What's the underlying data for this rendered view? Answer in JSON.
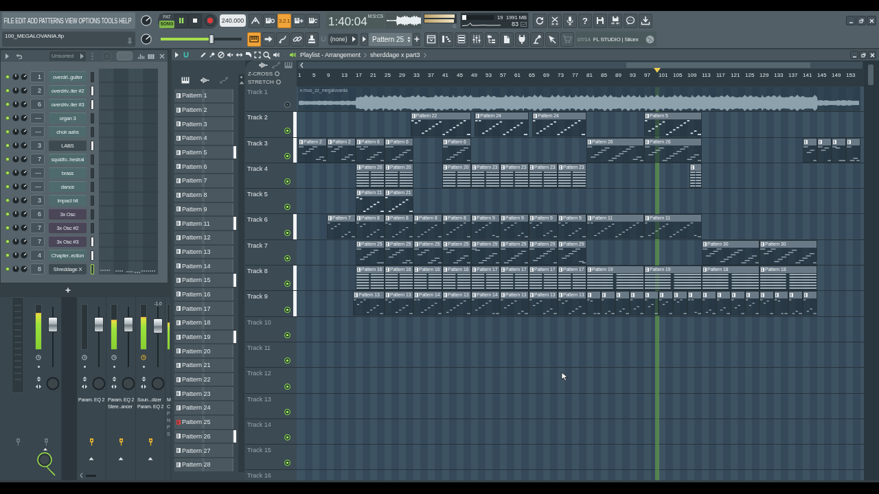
{
  "toolbar": {
    "menu": [
      "FILE",
      "EDIT",
      "ADD",
      "PATTERNS",
      "VIEW",
      "OPTIONS",
      "TOOLS",
      "HELP"
    ],
    "file_name": "100_MEGALOVANIA.flp",
    "modes": [
      {
        "label": "PAT",
        "selected": false
      },
      {
        "label": "SONG",
        "selected": true
      }
    ],
    "playing": true,
    "tempo": "240.000",
    "record_options": [
      {
        "on": false
      },
      {
        "on": false
      },
      {
        "label": "3.2.1",
        "on": true
      },
      {
        "on": false
      },
      {
        "on": false
      }
    ],
    "time": {
      "value": "1:40:04",
      "format": "M:S:CS"
    },
    "peak_meters": [
      {
        "level": 0.96
      },
      {
        "level": 0.93
      }
    ],
    "cpu": {
      "level": 0.12,
      "reading": "19",
      "memory": "1991 MB",
      "count": "83"
    },
    "help_button": "?",
    "master_volume": {
      "level": 0.63
    },
    "tools": [
      {
        "on": true
      },
      {
        "on": false
      },
      {
        "on": false
      },
      {
        "on": false
      },
      {
        "on": false
      }
    ],
    "dropdown": "(none)",
    "pattern": "Pattern 25",
    "hint": {
      "counter": "07/14",
      "text": "FL STUDIO | Slicex"
    }
  },
  "channel_rack": {
    "filter": "Unsorted",
    "channels": [
      {
        "number": "1",
        "name": "overdri..guiter",
        "color": "#4e6a6c",
        "selected": false,
        "focused": false
      },
      {
        "number": "2",
        "name": "overdriv..iter #2",
        "color": "#4e6a6c",
        "selected": true,
        "focused": false
      },
      {
        "number": "6",
        "name": "overdriv..iter #3",
        "color": "#4e6a6c",
        "selected": true,
        "focused": false
      },
      {
        "number": "---",
        "name": "organ 3",
        "color": "#4e6a6c",
        "selected": false,
        "focused": false
      },
      {
        "number": "---",
        "name": "choir aahs",
        "color": "#4e6a6c",
        "selected": false,
        "focused": false
      },
      {
        "number": "3",
        "name": "LABS",
        "color": "#3d4a50",
        "selected": true,
        "focused": false
      },
      {
        "number": "7",
        "name": "squidfo..hestral",
        "color": "#4e6a6c",
        "selected": false,
        "focused": false
      },
      {
        "number": "---",
        "name": "brass",
        "color": "#4e6a6c",
        "selected": false,
        "focused": false
      },
      {
        "number": "---",
        "name": "dance",
        "color": "#4e6a6c",
        "selected": false,
        "focused": false
      },
      {
        "number": "3",
        "name": "impact hit",
        "color": "#4e6a6c",
        "selected": false,
        "focused": false
      },
      {
        "number": "6",
        "name": "3x Osc",
        "color": "#4b4558",
        "selected": false,
        "focused": false
      },
      {
        "number": "7",
        "name": "3x Osc #2",
        "color": "#4b4558",
        "selected": false,
        "focused": false
      },
      {
        "number": "7",
        "name": "3x Osc #3",
        "color": "#4b4558",
        "selected": true,
        "focused": false
      },
      {
        "number": "4",
        "name": "Chapter..ection",
        "color": "#4e6a6c",
        "selected": true,
        "focused": false
      },
      {
        "number": "8",
        "name": "Shreddage X",
        "color": "#3d4a50",
        "selected": false,
        "focused": true
      }
    ]
  },
  "mixer": {
    "strips": [
      {
        "meter": {
          "level": 0.82
        },
        "fader": {
          "level": 0.78
        },
        "clock_on": false,
        "plug_on": false,
        "routed": true
      },
      {
        "meter": {
          "level": 0
        },
        "fader": {
          "level": 0.78
        },
        "clock_on": false,
        "plug_on": true,
        "routed": false,
        "fx": [
          {
            "label": "Param. EQ 2",
            "enabled": true
          }
        ]
      },
      {
        "meter": {
          "level": 0.66
        },
        "fader": {
          "level": 0.78
        },
        "clock_on": false,
        "plug_on": true,
        "routed": false,
        "fx": [
          {
            "label": "Param. EQ 2",
            "enabled": true
          },
          {
            "label": "Stere..ancer",
            "enabled": true
          }
        ]
      },
      {
        "meter": {
          "level": 0.73
        },
        "fader": {
          "level": 0.74
        },
        "reading": "-1.0",
        "clock_on": true,
        "plug_on": true,
        "routed": false,
        "fx": [
          {
            "label": "Soun...dizer",
            "enabled": true
          },
          {
            "label": "Param. EQ 2",
            "enabled": true
          }
        ]
      },
      {
        "meter": {
          "level": 0.6
        },
        "fx": [
          {
            "label": "M",
            "enabled": true
          },
          {
            "label": "C",
            "enabled": true
          },
          {
            "label": "P",
            "enabled": false
          },
          {
            "label": "N",
            "enabled": false
          },
          {
            "label": "P",
            "enabled": false
          },
          {
            "label": "S",
            "enabled": false
          }
        ]
      }
    ]
  },
  "playlist": {
    "title": "Playlist - Arrangement",
    "breadcrumb": "sherddage x part3",
    "options": [
      {
        "label": "Z-CROSS",
        "on": false
      },
      {
        "label": "STRETCH",
        "on": false
      }
    ],
    "patterns": [
      {
        "label": "Pattern 1",
        "selected": false,
        "current": false
      },
      {
        "label": "Pattern 2",
        "selected": false,
        "current": false
      },
      {
        "label": "Pattern 3",
        "selected": false,
        "current": false
      },
      {
        "label": "Pattern 4",
        "selected": false,
        "current": false
      },
      {
        "label": "Pattern 5",
        "selected": true,
        "current": false
      },
      {
        "label": "Pattern 6",
        "selected": false,
        "current": false
      },
      {
        "label": "Pattern 7",
        "selected": false,
        "current": false
      },
      {
        "label": "Pattern 8",
        "selected": false,
        "current": false
      },
      {
        "label": "Pattern 9",
        "selected": false,
        "current": false
      },
      {
        "label": "Pattern 11",
        "selected": true,
        "current": false
      },
      {
        "label": "Pattern 12",
        "selected": false,
        "current": false
      },
      {
        "label": "Pattern 13",
        "selected": false,
        "current": false
      },
      {
        "label": "Pattern 14",
        "selected": false,
        "current": false
      },
      {
        "label": "Pattern 15",
        "selected": true,
        "current": false
      },
      {
        "label": "Pattern 16",
        "selected": false,
        "current": false
      },
      {
        "label": "Pattern 17",
        "selected": false,
        "current": false
      },
      {
        "label": "Pattern 18",
        "selected": false,
        "current": false
      },
      {
        "label": "Pattern 19",
        "selected": true,
        "current": false
      },
      {
        "label": "Pattern 20",
        "selected": false,
        "current": false
      },
      {
        "label": "Pattern 21",
        "selected": false,
        "current": false
      },
      {
        "label": "Pattern 22",
        "selected": false,
        "current": false
      },
      {
        "label": "Pattern 23",
        "selected": false,
        "current": false
      },
      {
        "label": "Pattern 24",
        "selected": false,
        "current": false
      },
      {
        "label": "Pattern 25",
        "selected": false,
        "current": true
      },
      {
        "label": "Pattern 26",
        "selected": true,
        "current": false
      },
      {
        "label": "Pattern 27",
        "selected": false,
        "current": false
      },
      {
        "label": "Pattern 28",
        "selected": false,
        "current": false
      }
    ],
    "ruler": [
      "1",
      "5",
      "9",
      "13",
      "17",
      "21",
      "25",
      "29",
      "33",
      "37",
      "41",
      "45",
      "49",
      "53",
      "57",
      "61",
      "65",
      "69",
      "73",
      "77",
      "81",
      "85",
      "89",
      "93",
      "97",
      "101",
      "105",
      "109",
      "113",
      "117",
      "121",
      "125",
      "129",
      "133",
      "137",
      "141",
      "145",
      "149",
      "153"
    ],
    "playhead": {
      "level": 0.639
    },
    "tracks": [
      {
        "name": "Track 1",
        "selected": false,
        "muted": true,
        "dimmed": true,
        "clips": [
          {
            "kind": "audio",
            "label": "mus_zz_megalovania"
          }
        ]
      },
      {
        "name": "Track 2",
        "selected": true,
        "muted": false,
        "dimmed": false,
        "clips": [
          {
            "kind": "pattern",
            "label": "Pattern 22"
          },
          {
            "kind": "pattern",
            "label": "Pattern 24"
          },
          {
            "kind": "pattern",
            "label": "Pattern 24"
          },
          {
            "kind": "pattern",
            "label": "Pattern 5"
          }
        ]
      },
      {
        "name": "Track 3",
        "selected": true,
        "muted": false,
        "dimmed": false,
        "clips": [
          {
            "kind": "pattern",
            "label": "Pattern 2"
          },
          {
            "kind": "pattern",
            "label": "Pattern 2"
          },
          {
            "kind": "pattern",
            "label": "Pattern 6"
          },
          {
            "kind": "pattern",
            "label": "Pattern 6"
          },
          {
            "kind": "pattern",
            "label": "Pattern 6"
          },
          {
            "kind": "pattern",
            "label": "Pattern 26"
          },
          {
            "kind": "pattern",
            "label": "Pattern 26"
          },
          {
            "kind": "pattern"
          },
          {
            "kind": "pattern"
          },
          {
            "kind": "pattern"
          },
          {
            "kind": "pattern"
          }
        ]
      },
      {
        "name": "Track 4",
        "selected": false,
        "muted": false,
        "dimmed": false,
        "clips": [
          {
            "kind": "pattern",
            "label": "Pattern 20"
          },
          {
            "kind": "pattern",
            "label": "Pattern 20"
          },
          {
            "kind": "pattern",
            "label": "Pattern 20"
          },
          {
            "kind": "pattern",
            "label": "Pattern 23"
          },
          {
            "kind": "pattern",
            "label": "Pattern 23"
          },
          {
            "kind": "pattern",
            "label": "Pattern 23"
          },
          {
            "kind": "pattern",
            "label": "Pattern 23"
          },
          {
            "kind": "pattern"
          }
        ]
      },
      {
        "name": "Track 5",
        "selected": false,
        "muted": false,
        "dimmed": false,
        "clips": [
          {
            "kind": "pattern",
            "label": "Pattern 21"
          },
          {
            "kind": "pattern",
            "label": "Pattern 21"
          }
        ]
      },
      {
        "name": "Track 6",
        "selected": true,
        "muted": false,
        "dimmed": false,
        "clips": [
          {
            "kind": "pattern",
            "label": "Pattern 7"
          },
          {
            "kind": "pattern",
            "label": "Pattern 8"
          },
          {
            "kind": "pattern",
            "label": "Pattern 8"
          },
          {
            "kind": "pattern",
            "label": "Pattern 8"
          },
          {
            "kind": "pattern",
            "label": "Pattern 8"
          },
          {
            "kind": "pattern",
            "label": "Pattern 9"
          },
          {
            "kind": "pattern",
            "label": "Pattern 9"
          },
          {
            "kind": "pattern",
            "label": "Pattern 9"
          },
          {
            "kind": "pattern",
            "label": "Pattern 9"
          },
          {
            "kind": "pattern",
            "label": "Pattern 11"
          },
          {
            "kind": "pattern",
            "label": "Pattern 11"
          }
        ]
      },
      {
        "name": "Track 7",
        "selected": false,
        "muted": false,
        "dimmed": false,
        "clips": [
          {
            "kind": "pattern",
            "label": "Pattern 25"
          },
          {
            "kind": "pattern",
            "label": "Pattern 25"
          },
          {
            "kind": "pattern",
            "label": "Pattern 25"
          },
          {
            "kind": "pattern",
            "label": "Pattern 25"
          },
          {
            "kind": "pattern",
            "label": "Pattern 29"
          },
          {
            "kind": "pattern",
            "label": "Pattern 29"
          },
          {
            "kind": "pattern",
            "label": "Pattern 29"
          },
          {
            "kind": "pattern",
            "label": "Pattern 29"
          },
          {
            "kind": "pattern",
            "label": "Pattern 30"
          },
          {
            "kind": "pattern",
            "label": "Pattern 30"
          }
        ]
      },
      {
        "name": "Track 8",
        "selected": true,
        "muted": false,
        "dimmed": false,
        "clips": [
          {
            "kind": "pattern",
            "label": "Pattern 16"
          },
          {
            "kind": "pattern",
            "label": "Pattern 16"
          },
          {
            "kind": "pattern",
            "label": "Pattern 16"
          },
          {
            "kind": "pattern",
            "label": "Pattern 16"
          },
          {
            "kind": "pattern",
            "label": "Pattern 17"
          },
          {
            "kind": "pattern",
            "label": "Pattern 17"
          },
          {
            "kind": "pattern",
            "label": "Pattern 17"
          },
          {
            "kind": "pattern",
            "label": "Pattern 17"
          },
          {
            "kind": "pattern",
            "label": "Pattern 19"
          },
          {
            "kind": "pattern",
            "label": "Pattern 19"
          },
          {
            "kind": "pattern",
            "label": "Pattern 18"
          },
          {
            "kind": "pattern",
            "label": "Pattern 18"
          }
        ]
      },
      {
        "name": "Track 9",
        "selected": true,
        "muted": false,
        "dimmed": false,
        "clips": [
          {
            "kind": "pattern",
            "label": "Pattern 13"
          },
          {
            "kind": "pattern",
            "label": "Pattern 13"
          },
          {
            "kind": "pattern",
            "label": "Pattern 14"
          },
          {
            "kind": "pattern",
            "label": "Pattern 13"
          },
          {
            "kind": "pattern",
            "label": "Pattern 14"
          },
          {
            "kind": "pattern",
            "label": "Pattern 13"
          },
          {
            "kind": "pattern",
            "label": "Pattern 13"
          },
          {
            "kind": "pattern",
            "label": "Pattern 13"
          },
          {
            "kind": "pattern"
          },
          {
            "kind": "pattern"
          },
          {
            "kind": "pattern"
          },
          {
            "kind": "pattern"
          },
          {
            "kind": "pattern"
          },
          {
            "kind": "pattern"
          },
          {
            "kind": "pattern"
          },
          {
            "kind": "pattern"
          },
          {
            "kind": "pattern"
          },
          {
            "kind": "pattern"
          },
          {
            "kind": "pattern"
          },
          {
            "kind": "pattern"
          },
          {
            "kind": "pattern"
          },
          {
            "kind": "pattern"
          },
          {
            "kind": "pattern"
          },
          {
            "kind": "pattern"
          }
        ]
      },
      {
        "name": "Track 10",
        "selected": false,
        "muted": false,
        "dimmed": true
      },
      {
        "name": "Track 11",
        "selected": false,
        "muted": false,
        "dimmed": true
      },
      {
        "name": "Track 12",
        "selected": false,
        "muted": false,
        "dimmed": true
      },
      {
        "name": "Track 13",
        "selected": false,
        "muted": false,
        "dimmed": true
      },
      {
        "name": "Track 14",
        "selected": false,
        "muted": false,
        "dimmed": true
      },
      {
        "name": "Track 15",
        "selected": false,
        "muted": false,
        "dimmed": true
      },
      {
        "name": "Track 16",
        "selected": false,
        "dimmed": true
      }
    ]
  }
}
